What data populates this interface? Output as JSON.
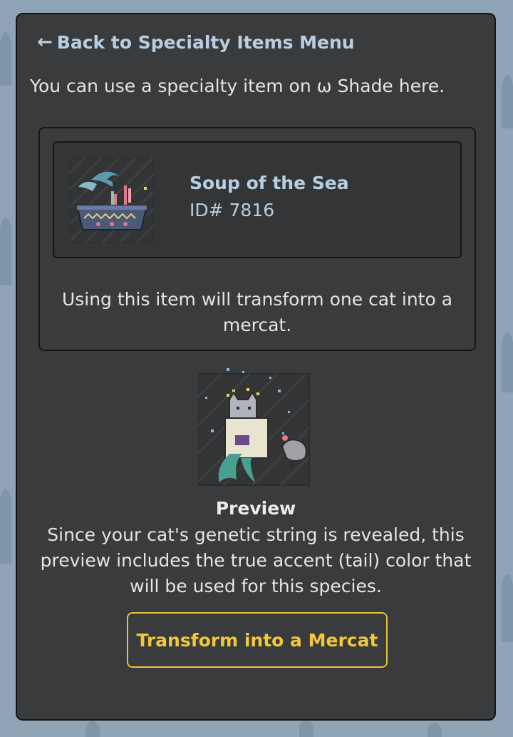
{
  "nav": {
    "back_arrow": "←",
    "back_label": "Back to Specialty Items Menu"
  },
  "intro_text": "You can use a specialty item on ω Shade here.",
  "item": {
    "name": "Soup of the Sea",
    "id_text": "ID# 7816",
    "icon": "soup-bowl-icon",
    "description": "Using this item will transform one cat into a mercat."
  },
  "preview": {
    "image": "mercat-preview-image",
    "title": "Preview",
    "text": "Since your cat's genetic string is revealed, this preview includes the true accent (tail) color that will be used for this species."
  },
  "action": {
    "transform_label": "Transform into a Mercat"
  },
  "colors": {
    "background": "#8fa4b6",
    "panel": "#3a3b3c",
    "link": "#b8cfe3",
    "button_accent": "#f0c83a"
  }
}
